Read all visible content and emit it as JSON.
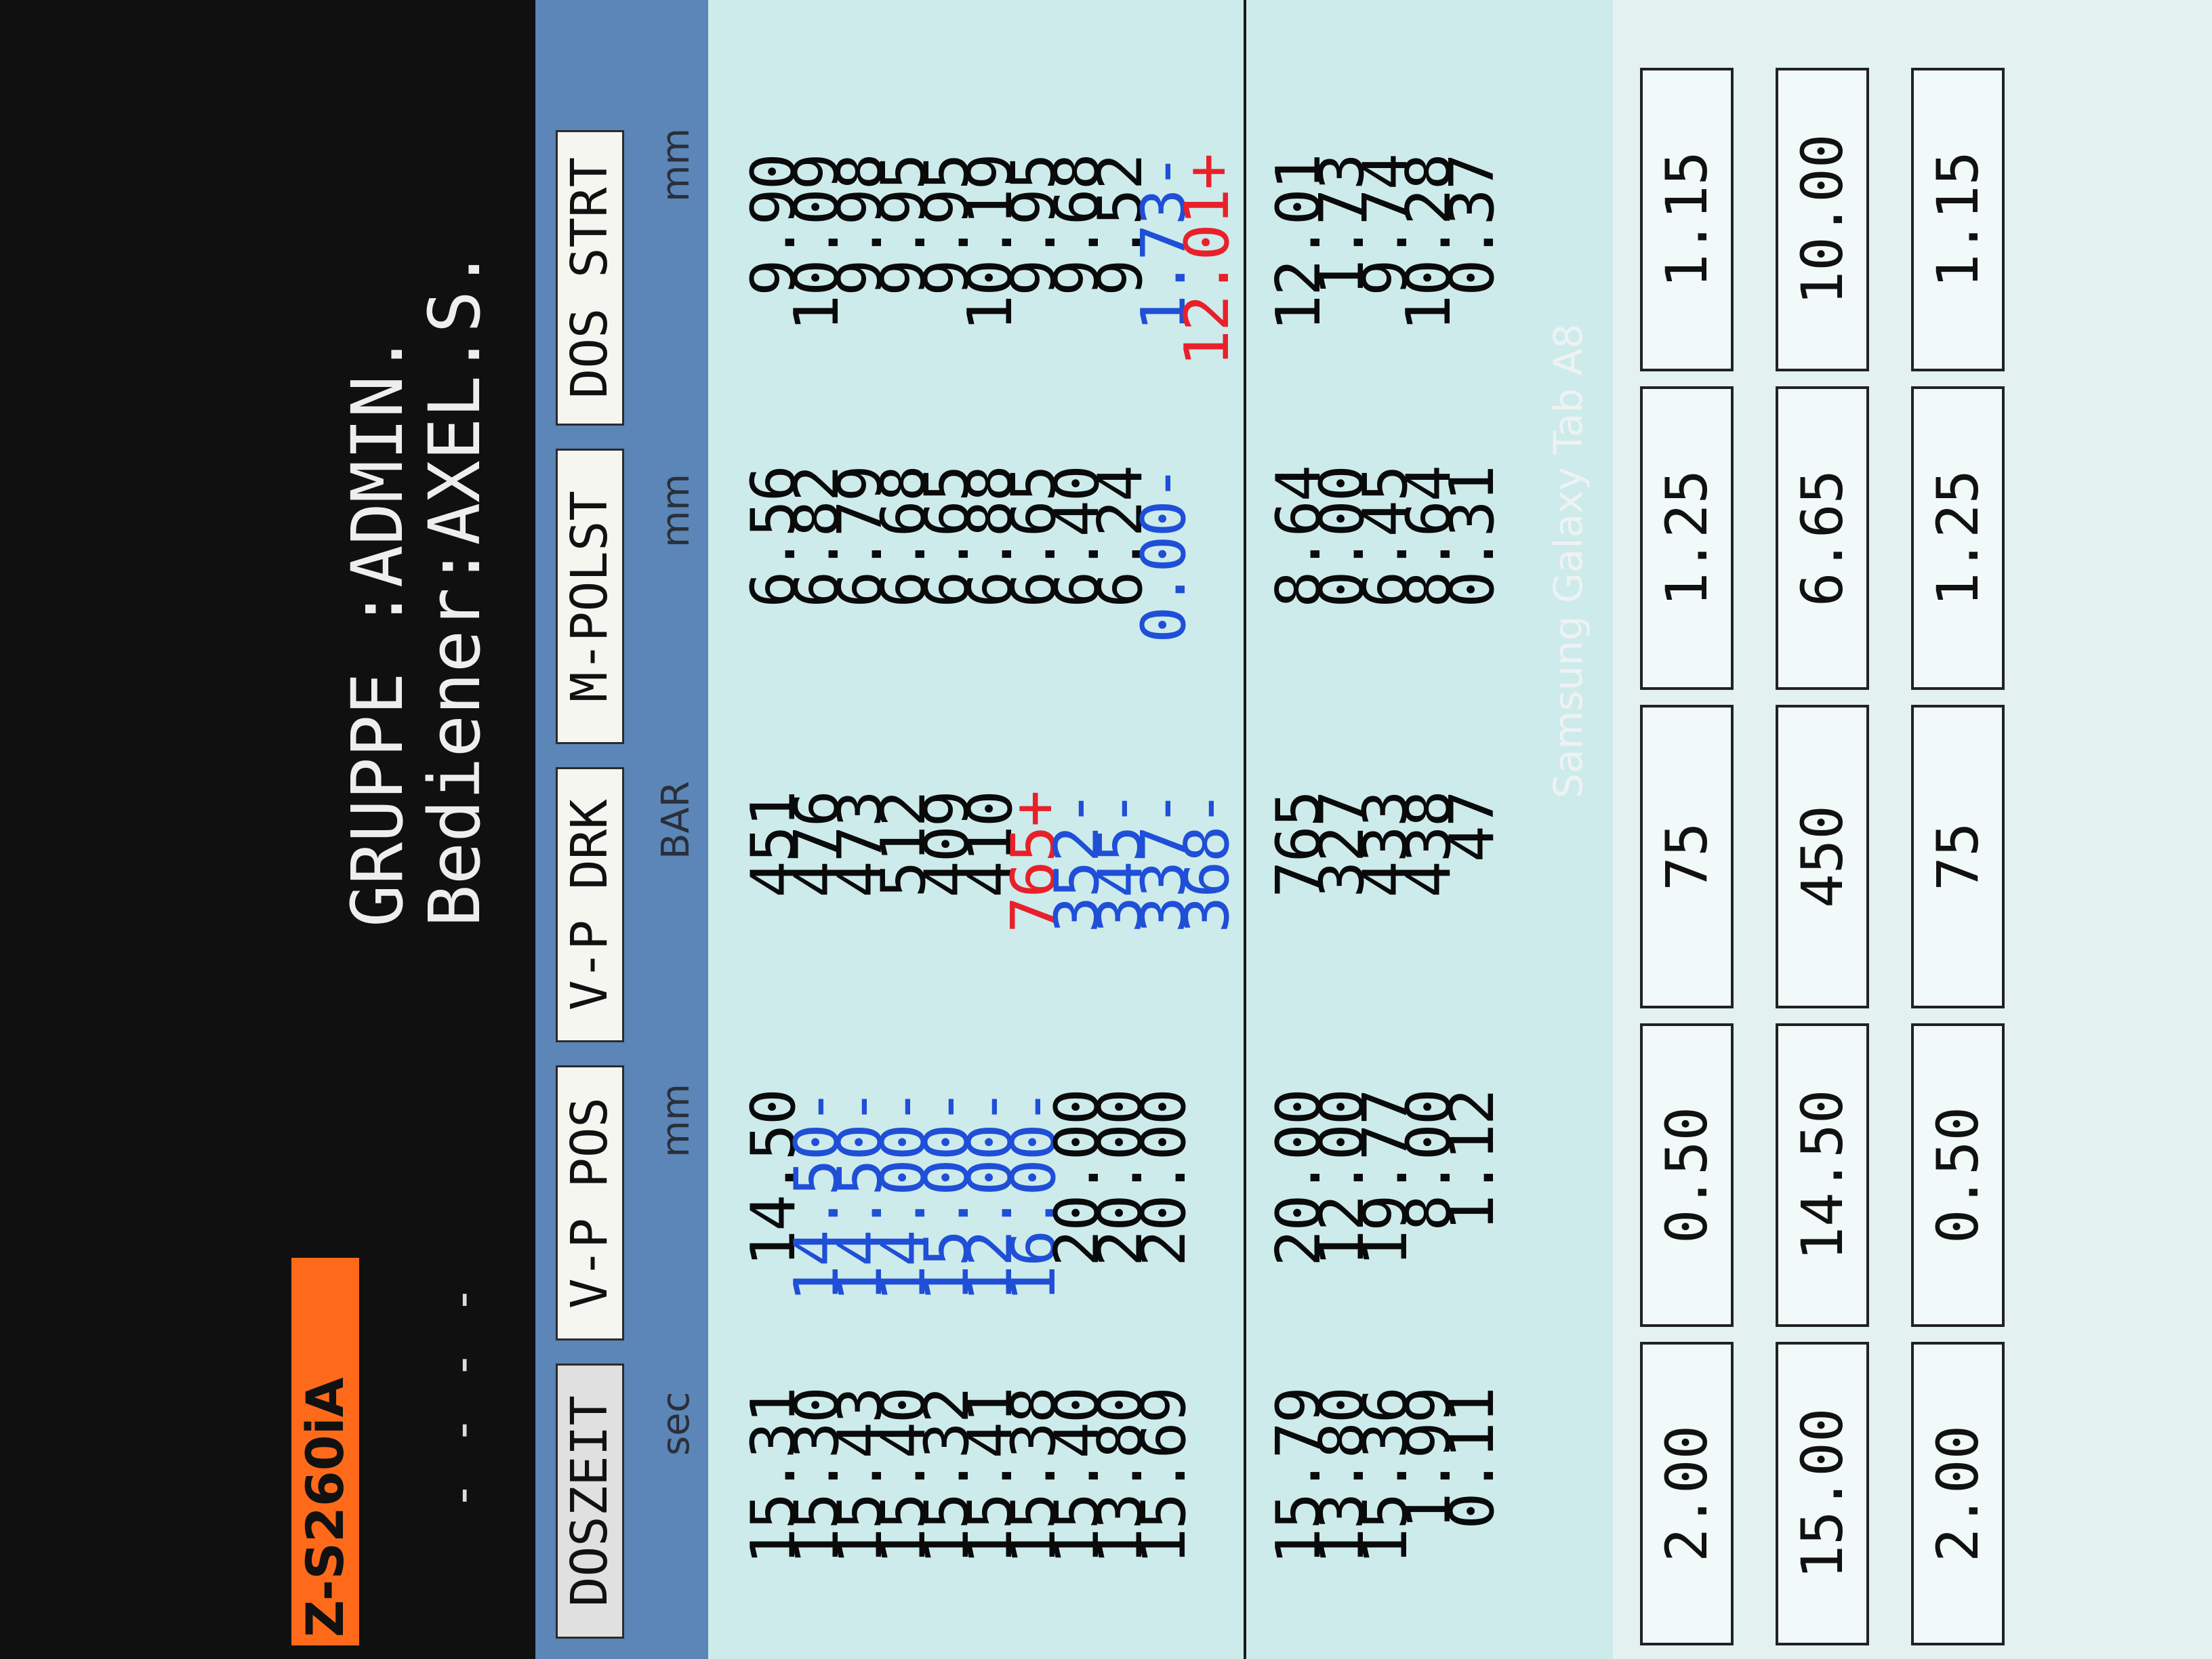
{
  "header": {
    "model": "Z-S260iA",
    "group_line": "GRUPPE :ADMIN.",
    "user_line": "Bediener:AXEL.S.",
    "dashes": "- - - -"
  },
  "tabs": [
    {
      "label": "DOSZEIT"
    },
    {
      "label": "V-P POS"
    },
    {
      "label": "V-P DRK"
    },
    {
      "label": "M-POLST"
    },
    {
      "label": "DOS STRT"
    }
  ],
  "units": [
    "sec",
    "mm",
    "BAR",
    "mm",
    "mm"
  ],
  "rows": [
    {
      "cells": [
        {
          "text": "15.31"
        },
        {
          "text": "14.50"
        },
        {
          "text": "451"
        },
        {
          "text": "6.56"
        },
        {
          "text": "9.90"
        }
      ]
    },
    {
      "cells": [
        {
          "text": "15.30"
        },
        {
          "text": "14.50-",
          "color": "blue"
        },
        {
          "text": "476"
        },
        {
          "text": "6.82"
        },
        {
          "text": "10.09"
        }
      ]
    },
    {
      "cells": [
        {
          "text": "15.43"
        },
        {
          "text": "14.50-",
          "color": "blue"
        },
        {
          "text": "473"
        },
        {
          "text": "6.79"
        },
        {
          "text": "9.98"
        }
      ]
    },
    {
      "cells": [
        {
          "text": "15.40"
        },
        {
          "text": "14.00-",
          "color": "blue"
        },
        {
          "text": "512"
        },
        {
          "text": "6.68"
        },
        {
          "text": "9.95"
        }
      ]
    },
    {
      "cells": [
        {
          "text": "15.32"
        },
        {
          "text": "15.00-",
          "color": "blue"
        },
        {
          "text": "409"
        },
        {
          "text": "6.65"
        },
        {
          "text": "9.95"
        }
      ]
    },
    {
      "cells": [
        {
          "text": "15.41"
        },
        {
          "text": "12.00-",
          "color": "blue"
        },
        {
          "text": "410"
        },
        {
          "text": "6.88"
        },
        {
          "text": "10.19"
        }
      ]
    },
    {
      "cells": [
        {
          "text": "15.38"
        },
        {
          "text": "16.00-",
          "color": "blue"
        },
        {
          "text": "765+",
          "color": "red"
        },
        {
          "text": "6.65"
        },
        {
          "text": "9.95"
        }
      ]
    },
    {
      "cells": [
        {
          "text": "15.40"
        },
        {
          "text": "20.00"
        },
        {
          "text": "352-",
          "color": "blue"
        },
        {
          "text": "6.40"
        },
        {
          "text": "9.68"
        }
      ]
    },
    {
      "cells": [
        {
          "text": "13.80"
        },
        {
          "text": "20.00"
        },
        {
          "text": "345-",
          "color": "blue"
        },
        {
          "text": "6.24"
        },
        {
          "text": "9.52"
        }
      ]
    },
    {
      "cells": [
        {
          "text": "15.69"
        },
        {
          "text": "20.00"
        },
        {
          "text": "337-",
          "color": "blue"
        },
        {
          "text": "0.00-",
          "color": "blue"
        },
        {
          "text": "1.73-",
          "color": "blue"
        }
      ]
    },
    {
      "cells": [
        {
          "text": ""
        },
        {
          "text": ""
        },
        {
          "text": "368-",
          "color": "blue"
        },
        {
          "text": ""
        },
        {
          "text": "12.01+",
          "color": "red"
        }
      ]
    }
  ],
  "stats": [
    {
      "cells": [
        {
          "text": "15.79"
        },
        {
          "text": "20.00"
        },
        {
          "text": "765"
        },
        {
          "text": "8.64"
        },
        {
          "text": "12.01"
        }
      ]
    },
    {
      "cells": [
        {
          "text": "13.80"
        },
        {
          "text": "12.00"
        },
        {
          "text": "327"
        },
        {
          "text": "0.00"
        },
        {
          "text": "1.73"
        }
      ]
    },
    {
      "cells": [
        {
          "text": "15.36"
        },
        {
          "text": "19.77"
        },
        {
          "text": "433"
        },
        {
          "text": "6.45"
        },
        {
          "text": "9.74"
        }
      ]
    },
    {
      "cells": [
        {
          "text": "1.99"
        },
        {
          "text": "8.00"
        },
        {
          "text": "438"
        },
        {
          "text": "8.64"
        },
        {
          "text": "10.28"
        }
      ]
    },
    {
      "cells": [
        {
          "text": "0.11"
        },
        {
          "text": "1.12"
        },
        {
          "text": "47"
        },
        {
          "text": "0.31"
        },
        {
          "text": "0.37"
        }
      ]
    }
  ],
  "inputs": [
    {
      "cells": [
        "2.00",
        "0.50",
        "75",
        "1.25",
        "1.15"
      ]
    },
    {
      "cells": [
        "15.00",
        "14.50",
        "450",
        "6.65",
        "10.00"
      ]
    },
    {
      "cells": [
        "2.00",
        "0.50",
        "75",
        "1.25",
        "1.15"
      ]
    }
  ],
  "watermark": "Samsung Galaxy Tab A8"
}
